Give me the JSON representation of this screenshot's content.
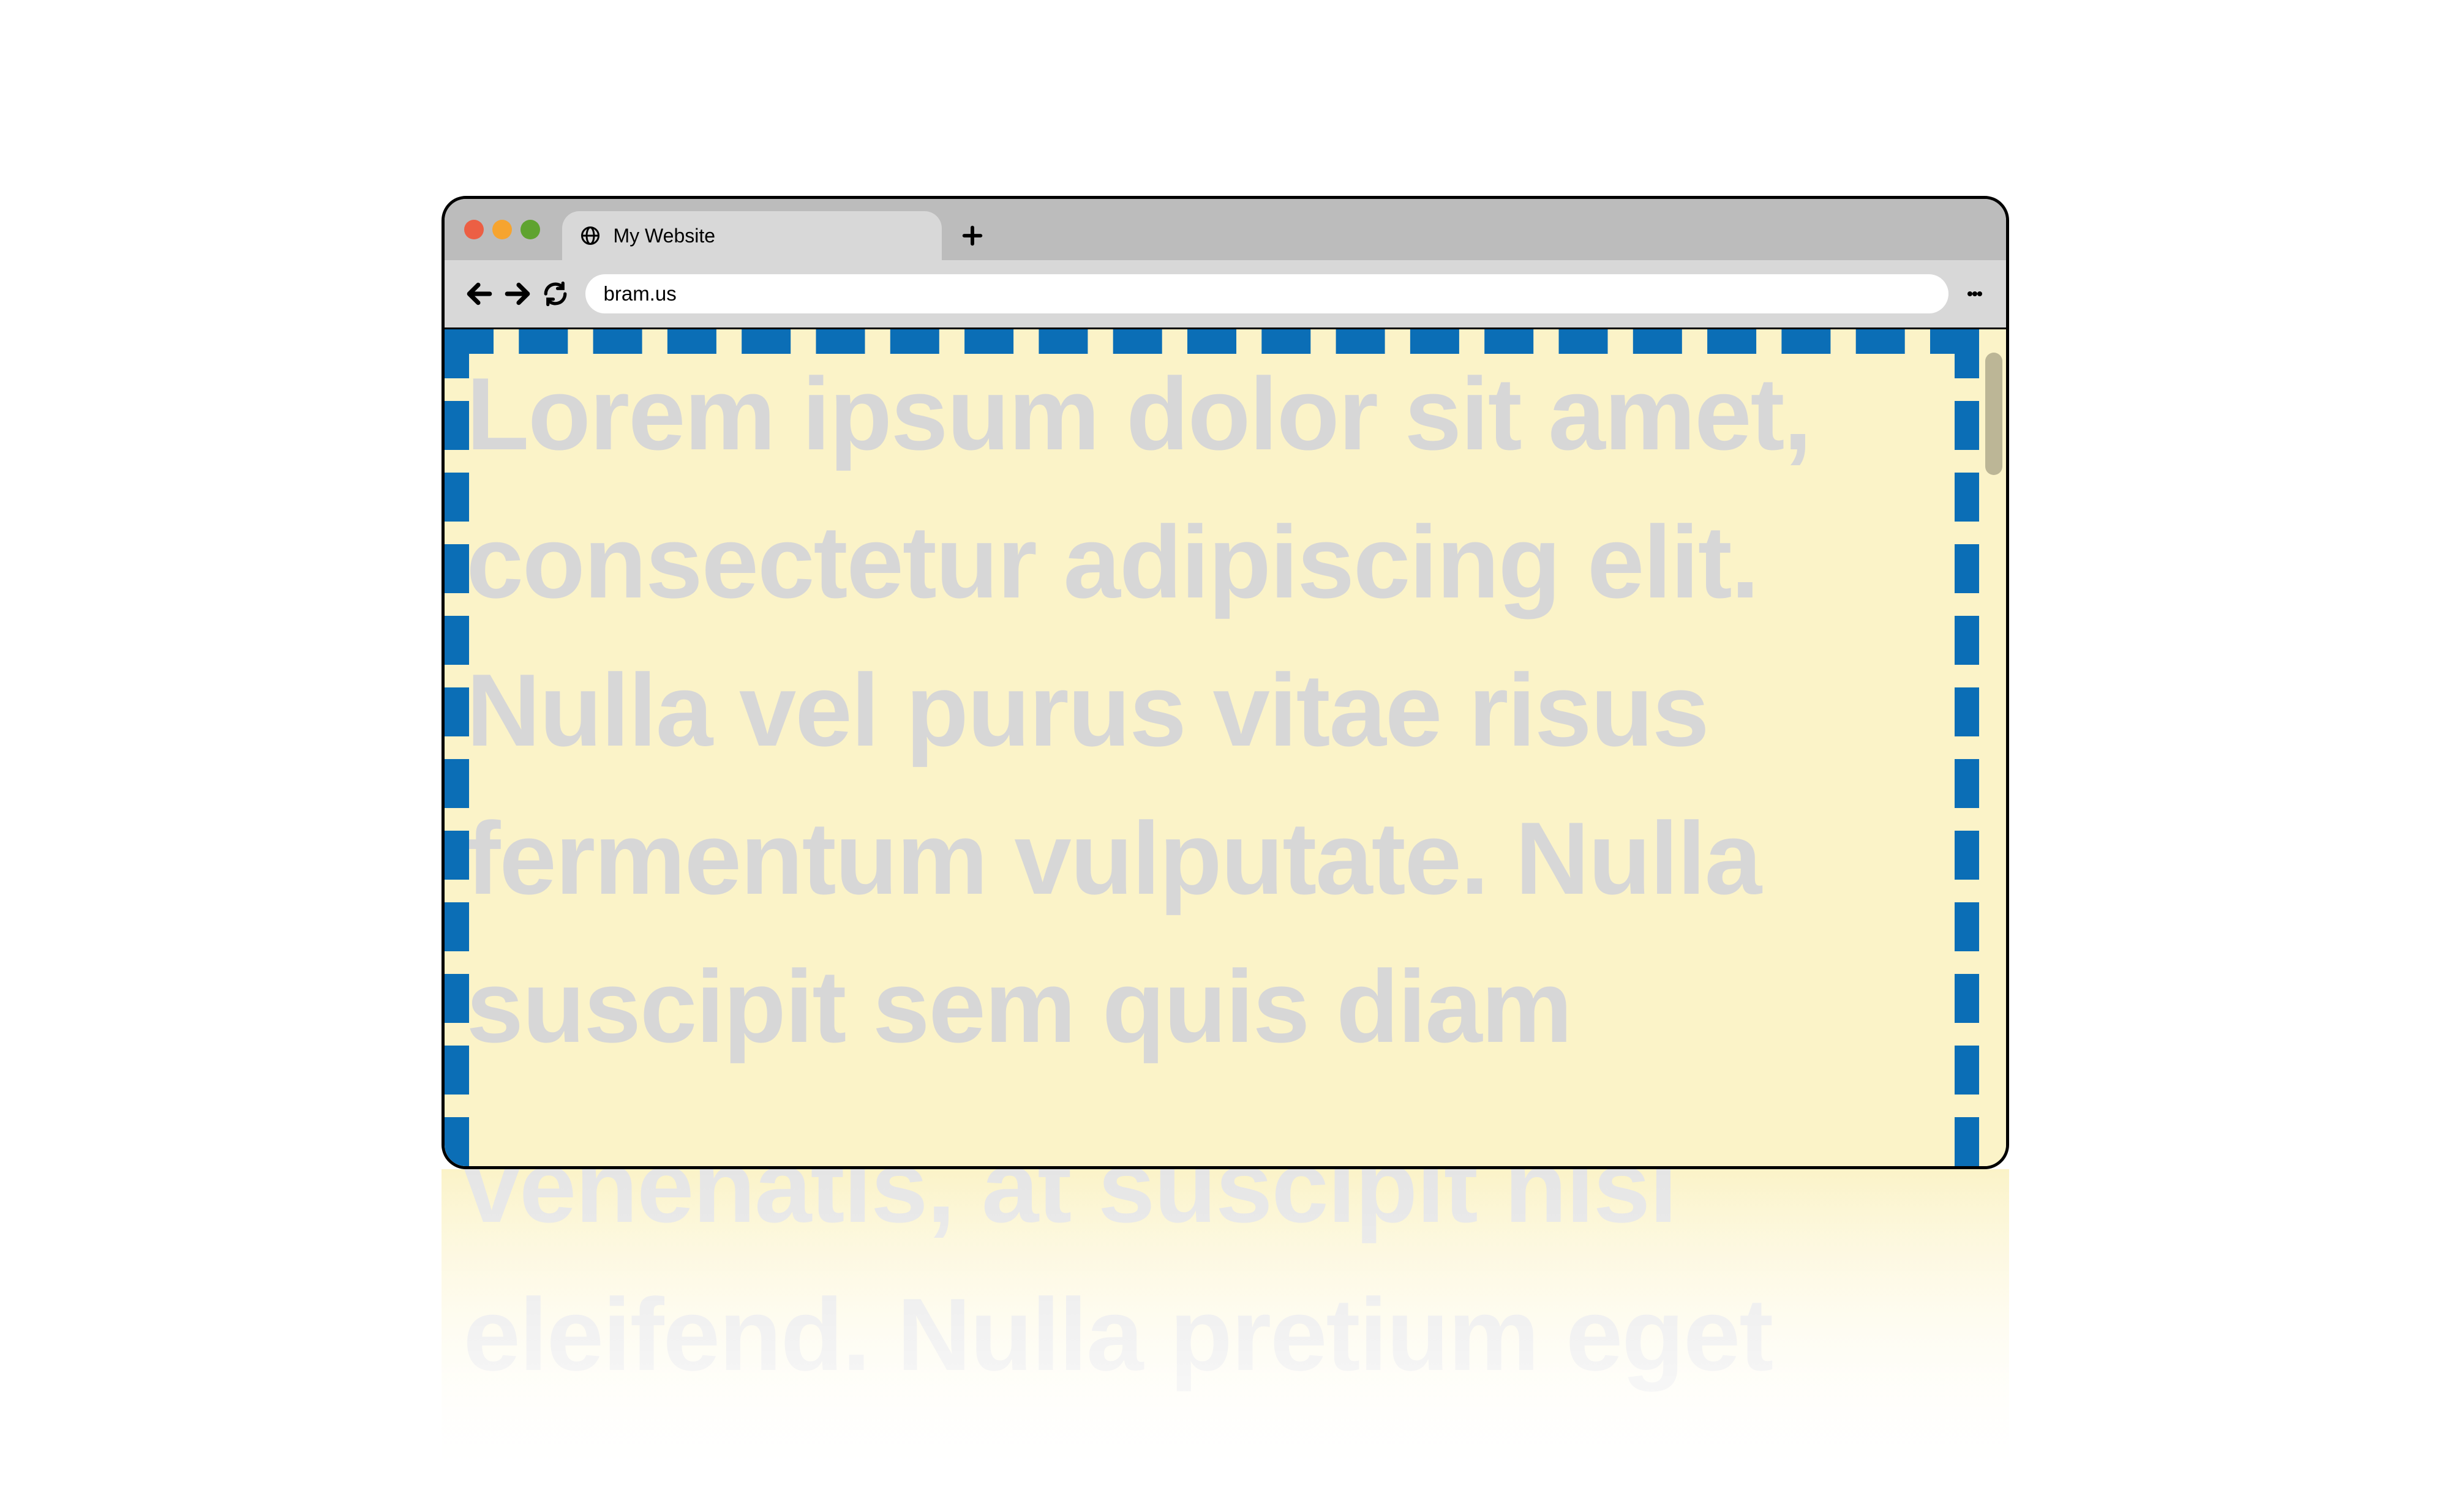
{
  "window": {
    "traffic_lights": {
      "close": "#ec5f44",
      "minimize": "#f6a42f",
      "zoom": "#5fa32f"
    }
  },
  "tabstrip": {
    "tabs": [
      {
        "icon": "globe-icon",
        "title": "My Website"
      }
    ],
    "new_tab_label": "+"
  },
  "toolbar": {
    "back_label": "Back",
    "forward_label": "Forward",
    "reload_label": "Reload",
    "menu_label": "More",
    "address": "bram.us"
  },
  "page": {
    "background": "#fbf3c8",
    "dash_color": "#0b6eb6",
    "text_color": "#d7d7d7",
    "body_text_visible": "Lorem ipsum dolor sit amet, consectetur adipiscing elit. Nulla vel purus vitae risus fermentum vulputate. Nulla suscipit sem quis diam",
    "body_text_overflow": "venenatis, at suscipit nisl eleifend. Nulla pretium eget"
  }
}
